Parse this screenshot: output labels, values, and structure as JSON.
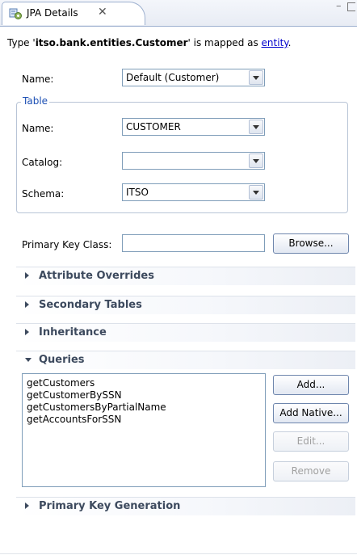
{
  "view": {
    "tab_title": "JPA Details",
    "tab_close": "✕",
    "minimize": "–"
  },
  "type_line": {
    "prefix": "Type '",
    "entity_name": "itso.bank.entities.Customer",
    "middle": "' is mapped as ",
    "mapping_link": "entity",
    "suffix": "."
  },
  "entity_name_field": {
    "label": "Name:",
    "value": "Default (Customer)"
  },
  "table_group": {
    "title": "Table",
    "name": {
      "label": "Name:",
      "value": "CUSTOMER"
    },
    "catalog": {
      "label": "Catalog:",
      "value": ""
    },
    "schema": {
      "label": "Schema:",
      "value": "ITSO"
    }
  },
  "primary_key_class": {
    "label": "Primary Key Class:",
    "value": "",
    "browse_label": "Browse..."
  },
  "sections": {
    "attribute_overrides": {
      "title": "Attribute Overrides",
      "expanded": false
    },
    "secondary_tables": {
      "title": "Secondary Tables",
      "expanded": false
    },
    "inheritance": {
      "title": "Inheritance",
      "expanded": false
    },
    "queries": {
      "title": "Queries",
      "expanded": true
    },
    "primary_key_generation": {
      "title": "Primary Key Generation",
      "expanded": false
    }
  },
  "queries": {
    "items": [
      "getCustomers",
      "getCustomerBySSN",
      "getCustomersByPartialName",
      "getAccountsForSSN"
    ],
    "buttons": {
      "add": "Add...",
      "add_native": "Add Native...",
      "edit": "Edit...",
      "remove": "Remove"
    }
  },
  "colors": {
    "group_title": "#1c4fb4",
    "section_title": "#3d4a5e",
    "link": "#0000cc",
    "disabled_text": "#a0a0a0"
  }
}
